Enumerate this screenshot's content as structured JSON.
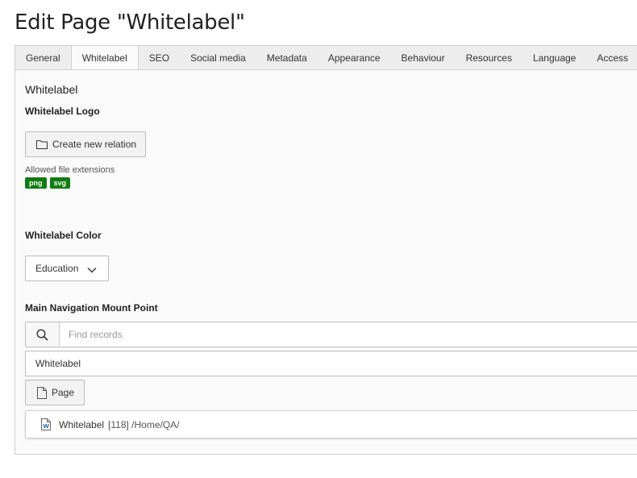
{
  "page": {
    "title": "Edit Page \"Whitelabel\""
  },
  "tabs": [
    {
      "label": "General"
    },
    {
      "label": "Whitelabel"
    },
    {
      "label": "SEO"
    },
    {
      "label": "Social media"
    },
    {
      "label": "Metadata"
    },
    {
      "label": "Appearance"
    },
    {
      "label": "Behaviour"
    },
    {
      "label": "Resources"
    },
    {
      "label": "Language"
    },
    {
      "label": "Access"
    }
  ],
  "active_tab": "Whitelabel",
  "section": {
    "title": "Whitelabel"
  },
  "logo": {
    "label": "Whitelabel Logo",
    "button_label": "Create new relation",
    "button_icon": "folder-icon",
    "allowed_label": "Allowed file extensions",
    "extensions": [
      "png",
      "svg"
    ],
    "badge_color": "#107c10"
  },
  "color": {
    "label": "Whitelabel Color",
    "selected": "Education"
  },
  "mount_point": {
    "label": "Main Navigation Mount Point",
    "search_placeholder": "Find records",
    "value": "Whitelabel",
    "page_button_label": "Page",
    "record": {
      "title": "Whitelabel",
      "meta": "[118] /Home/QA/"
    }
  }
}
